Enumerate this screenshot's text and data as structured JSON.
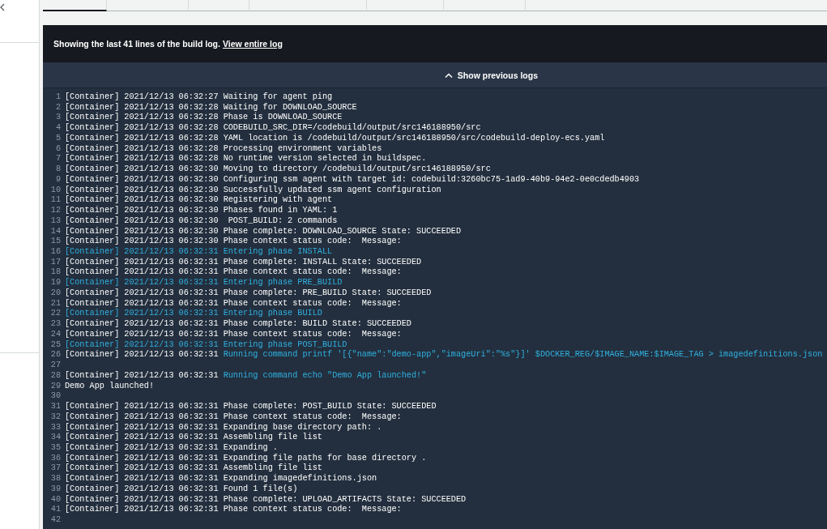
{
  "tabs": [
    {
      "selected": true
    },
    {
      "selected": false
    },
    {
      "selected": false
    },
    {
      "selected": false
    },
    {
      "selected": false
    },
    {
      "selected": false
    }
  ],
  "log_panel": {
    "notice": "Showing the last 41 lines of the build log.",
    "link": "View entire log",
    "show_previous": "Show previous logs",
    "lines": [
      {
        "number": "1",
        "kind": "normal",
        "prefix": "[Container] 2021/12/13 06:32:27",
        "message": "Waiting for agent ping"
      },
      {
        "number": "2",
        "kind": "normal",
        "prefix": "[Container] 2021/12/13 06:32:28",
        "message": "Waiting for DOWNLOAD_SOURCE"
      },
      {
        "number": "3",
        "kind": "normal",
        "prefix": "[Container] 2021/12/13 06:32:28",
        "message": "Phase is DOWNLOAD_SOURCE"
      },
      {
        "number": "4",
        "kind": "normal",
        "prefix": "[Container] 2021/12/13 06:32:28",
        "message": "CODEBUILD_SRC_DIR=/codebuild/output/src146188950/src"
      },
      {
        "number": "5",
        "kind": "normal",
        "prefix": "[Container] 2021/12/13 06:32:28",
        "message": "YAML location is /codebuild/output/src146188950/src/codebuild-deploy-ecs.yaml"
      },
      {
        "number": "6",
        "kind": "normal",
        "prefix": "[Container] 2021/12/13 06:32:28",
        "message": "Processing environment variables"
      },
      {
        "number": "7",
        "kind": "normal",
        "prefix": "[Container] 2021/12/13 06:32:28",
        "message": "No runtime version selected in buildspec."
      },
      {
        "number": "8",
        "kind": "normal",
        "prefix": "[Container] 2021/12/13 06:32:30",
        "message": "Moving to directory /codebuild/output/src146188950/src"
      },
      {
        "number": "9",
        "kind": "normal",
        "prefix": "[Container] 2021/12/13 06:32:30",
        "message": "Configuring ssm agent with target id: codebuild:3260bc75-1ad9-40b9-94e2-0e0cdedb4903"
      },
      {
        "number": "10",
        "kind": "normal",
        "prefix": "[Container] 2021/12/13 06:32:30",
        "message": "Successfully updated ssm agent configuration"
      },
      {
        "number": "11",
        "kind": "normal",
        "prefix": "[Container] 2021/12/13 06:32:30",
        "message": "Registering with agent"
      },
      {
        "number": "12",
        "kind": "normal",
        "prefix": "[Container] 2021/12/13 06:32:30",
        "message": "Phases found in YAML: 1"
      },
      {
        "number": "13",
        "kind": "normal",
        "prefix": "[Container] 2021/12/13 06:32:30",
        "message": " POST_BUILD: 2 commands"
      },
      {
        "number": "14",
        "kind": "normal",
        "prefix": "[Container] 2021/12/13 06:32:30",
        "message": "Phase complete: DOWNLOAD_SOURCE State: SUCCEEDED"
      },
      {
        "number": "15",
        "kind": "normal",
        "prefix": "[Container] 2021/12/13 06:32:30",
        "message": "Phase context status code:  Message:"
      },
      {
        "number": "16",
        "kind": "phase",
        "prefix": "[Container] 2021/12/13 06:32:31",
        "message": "Entering phase INSTALL"
      },
      {
        "number": "17",
        "kind": "normal",
        "prefix": "[Container] 2021/12/13 06:32:31",
        "message": "Phase complete: INSTALL State: SUCCEEDED"
      },
      {
        "number": "18",
        "kind": "normal",
        "prefix": "[Container] 2021/12/13 06:32:31",
        "message": "Phase context status code:  Message:"
      },
      {
        "number": "19",
        "kind": "phase",
        "prefix": "[Container] 2021/12/13 06:32:31",
        "message": "Entering phase PRE_BUILD"
      },
      {
        "number": "20",
        "kind": "normal",
        "prefix": "[Container] 2021/12/13 06:32:31",
        "message": "Phase complete: PRE_BUILD State: SUCCEEDED"
      },
      {
        "number": "21",
        "kind": "normal",
        "prefix": "[Container] 2021/12/13 06:32:31",
        "message": "Phase context status code:  Message:"
      },
      {
        "number": "22",
        "kind": "phase",
        "prefix": "[Container] 2021/12/13 06:32:31",
        "message": "Entering phase BUILD"
      },
      {
        "number": "23",
        "kind": "normal",
        "prefix": "[Container] 2021/12/13 06:32:31",
        "message": "Phase complete: BUILD State: SUCCEEDED"
      },
      {
        "number": "24",
        "kind": "normal",
        "prefix": "[Container] 2021/12/13 06:32:31",
        "message": "Phase context status code:  Message:"
      },
      {
        "number": "25",
        "kind": "phase",
        "prefix": "[Container] 2021/12/13 06:32:31",
        "message": "Entering phase POST_BUILD"
      },
      {
        "number": "26",
        "kind": "command",
        "prefix": "[Container] 2021/12/13 06:32:31",
        "message": "Running command printf '[{\"name\":\"demo-app\",\"imageUri\":\"%s\"}]' $DOCKER_REG/$IMAGE_NAME:$IMAGE_TAG > imagedefinitions.json"
      },
      {
        "number": "27",
        "kind": "blank"
      },
      {
        "number": "28",
        "kind": "command",
        "prefix": "[Container] 2021/12/13 06:32:31",
        "message": "Running command echo \"Demo App launched!\""
      },
      {
        "number": "29",
        "kind": "output",
        "message": "Demo App launched!"
      },
      {
        "number": "30",
        "kind": "blank"
      },
      {
        "number": "31",
        "kind": "normal",
        "prefix": "[Container] 2021/12/13 06:32:31",
        "message": "Phase complete: POST_BUILD State: SUCCEEDED"
      },
      {
        "number": "32",
        "kind": "normal",
        "prefix": "[Container] 2021/12/13 06:32:31",
        "message": "Phase context status code:  Message:"
      },
      {
        "number": "33",
        "kind": "normal",
        "prefix": "[Container] 2021/12/13 06:32:31",
        "message": "Expanding base directory path: ."
      },
      {
        "number": "34",
        "kind": "normal",
        "prefix": "[Container] 2021/12/13 06:32:31",
        "message": "Assembling file list"
      },
      {
        "number": "35",
        "kind": "normal",
        "prefix": "[Container] 2021/12/13 06:32:31",
        "message": "Expanding ."
      },
      {
        "number": "36",
        "kind": "normal",
        "prefix": "[Container] 2021/12/13 06:32:31",
        "message": "Expanding file paths for base directory ."
      },
      {
        "number": "37",
        "kind": "normal",
        "prefix": "[Container] 2021/12/13 06:32:31",
        "message": "Assembling file list"
      },
      {
        "number": "38",
        "kind": "normal",
        "prefix": "[Container] 2021/12/13 06:32:31",
        "message": "Expanding imagedefinitions.json"
      },
      {
        "number": "39",
        "kind": "normal",
        "prefix": "[Container] 2021/12/13 06:32:31",
        "message": "Found 1 file(s)"
      },
      {
        "number": "40",
        "kind": "normal",
        "prefix": "[Container] 2021/12/13 06:32:31",
        "message": "Phase complete: UPLOAD_ARTIFACTS State: SUCCEEDED"
      },
      {
        "number": "41",
        "kind": "normal",
        "prefix": "[Container] 2021/12/13 06:32:31",
        "message": "Phase context status code:  Message:"
      },
      {
        "number": "42",
        "kind": "blank"
      }
    ]
  }
}
